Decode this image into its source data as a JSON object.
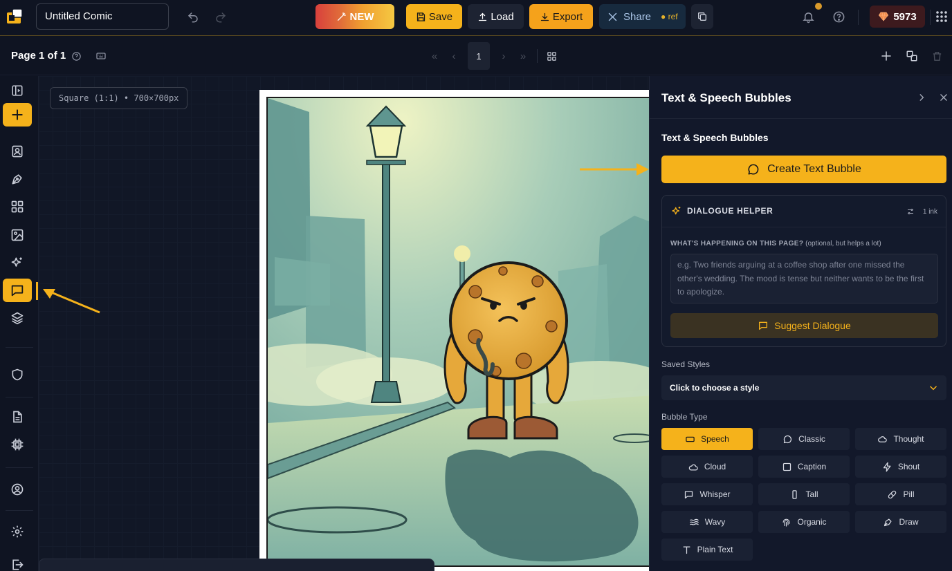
{
  "topbar": {
    "comic_title": "Untitled Comic",
    "new_label": "NEW",
    "save_label": "Save",
    "load_label": "Load",
    "export_label": "Export",
    "share_label": "Share",
    "share_ref": "ref",
    "gems_count": "5973"
  },
  "pagebar": {
    "page_label": "Page 1 of 1",
    "current_page": "1"
  },
  "canvas": {
    "size_badge": "Square (1:1) • 700×700px"
  },
  "panel": {
    "title": "Text & Speech Bubbles",
    "subtitle": "Text & Speech Bubbles",
    "create_button": "Create Text Bubble",
    "dialogue_helper": {
      "title": "DIALOGUE HELPER",
      "ink_cost": "1 ink",
      "question": "WHAT'S HAPPENING ON THIS PAGE?",
      "question_hint": "(optional, but helps a lot)",
      "placeholder": "e.g. Two friends arguing at a coffee shop after one missed the other's wedding. The mood is tense but neither wants to be the first to apologize.",
      "suggest_button": "Suggest Dialogue"
    },
    "saved_styles_label": "Saved Styles",
    "style_select": "Click to choose a style",
    "bubble_type_label": "Bubble Type",
    "bubble_types": [
      {
        "label": "Speech",
        "icon": "speech-rect-icon",
        "active": true
      },
      {
        "label": "Classic",
        "icon": "speech-round-icon",
        "active": false
      },
      {
        "label": "Thought",
        "icon": "thought-cloud-icon",
        "active": false
      },
      {
        "label": "Cloud",
        "icon": "cloud-icon",
        "active": false
      },
      {
        "label": "Caption",
        "icon": "caption-square-icon",
        "active": false
      },
      {
        "label": "Shout",
        "icon": "lightning-icon",
        "active": false
      },
      {
        "label": "Whisper",
        "icon": "whisper-bubble-icon",
        "active": false
      },
      {
        "label": "Tall",
        "icon": "tall-rect-icon",
        "active": false
      },
      {
        "label": "Pill",
        "icon": "pill-icon",
        "active": false
      },
      {
        "label": "Wavy",
        "icon": "wavy-lines-icon",
        "active": false
      },
      {
        "label": "Organic",
        "icon": "fingerprint-icon",
        "active": false
      },
      {
        "label": "Draw",
        "icon": "pen-draw-icon",
        "active": false
      },
      {
        "label": "Plain Text",
        "icon": "text-t-icon",
        "active": false
      }
    ]
  },
  "colors": {
    "accent": "#f5b21b",
    "background": "#0d1220",
    "panel": "#12182a",
    "gems_bg": "#3d1a1e"
  }
}
